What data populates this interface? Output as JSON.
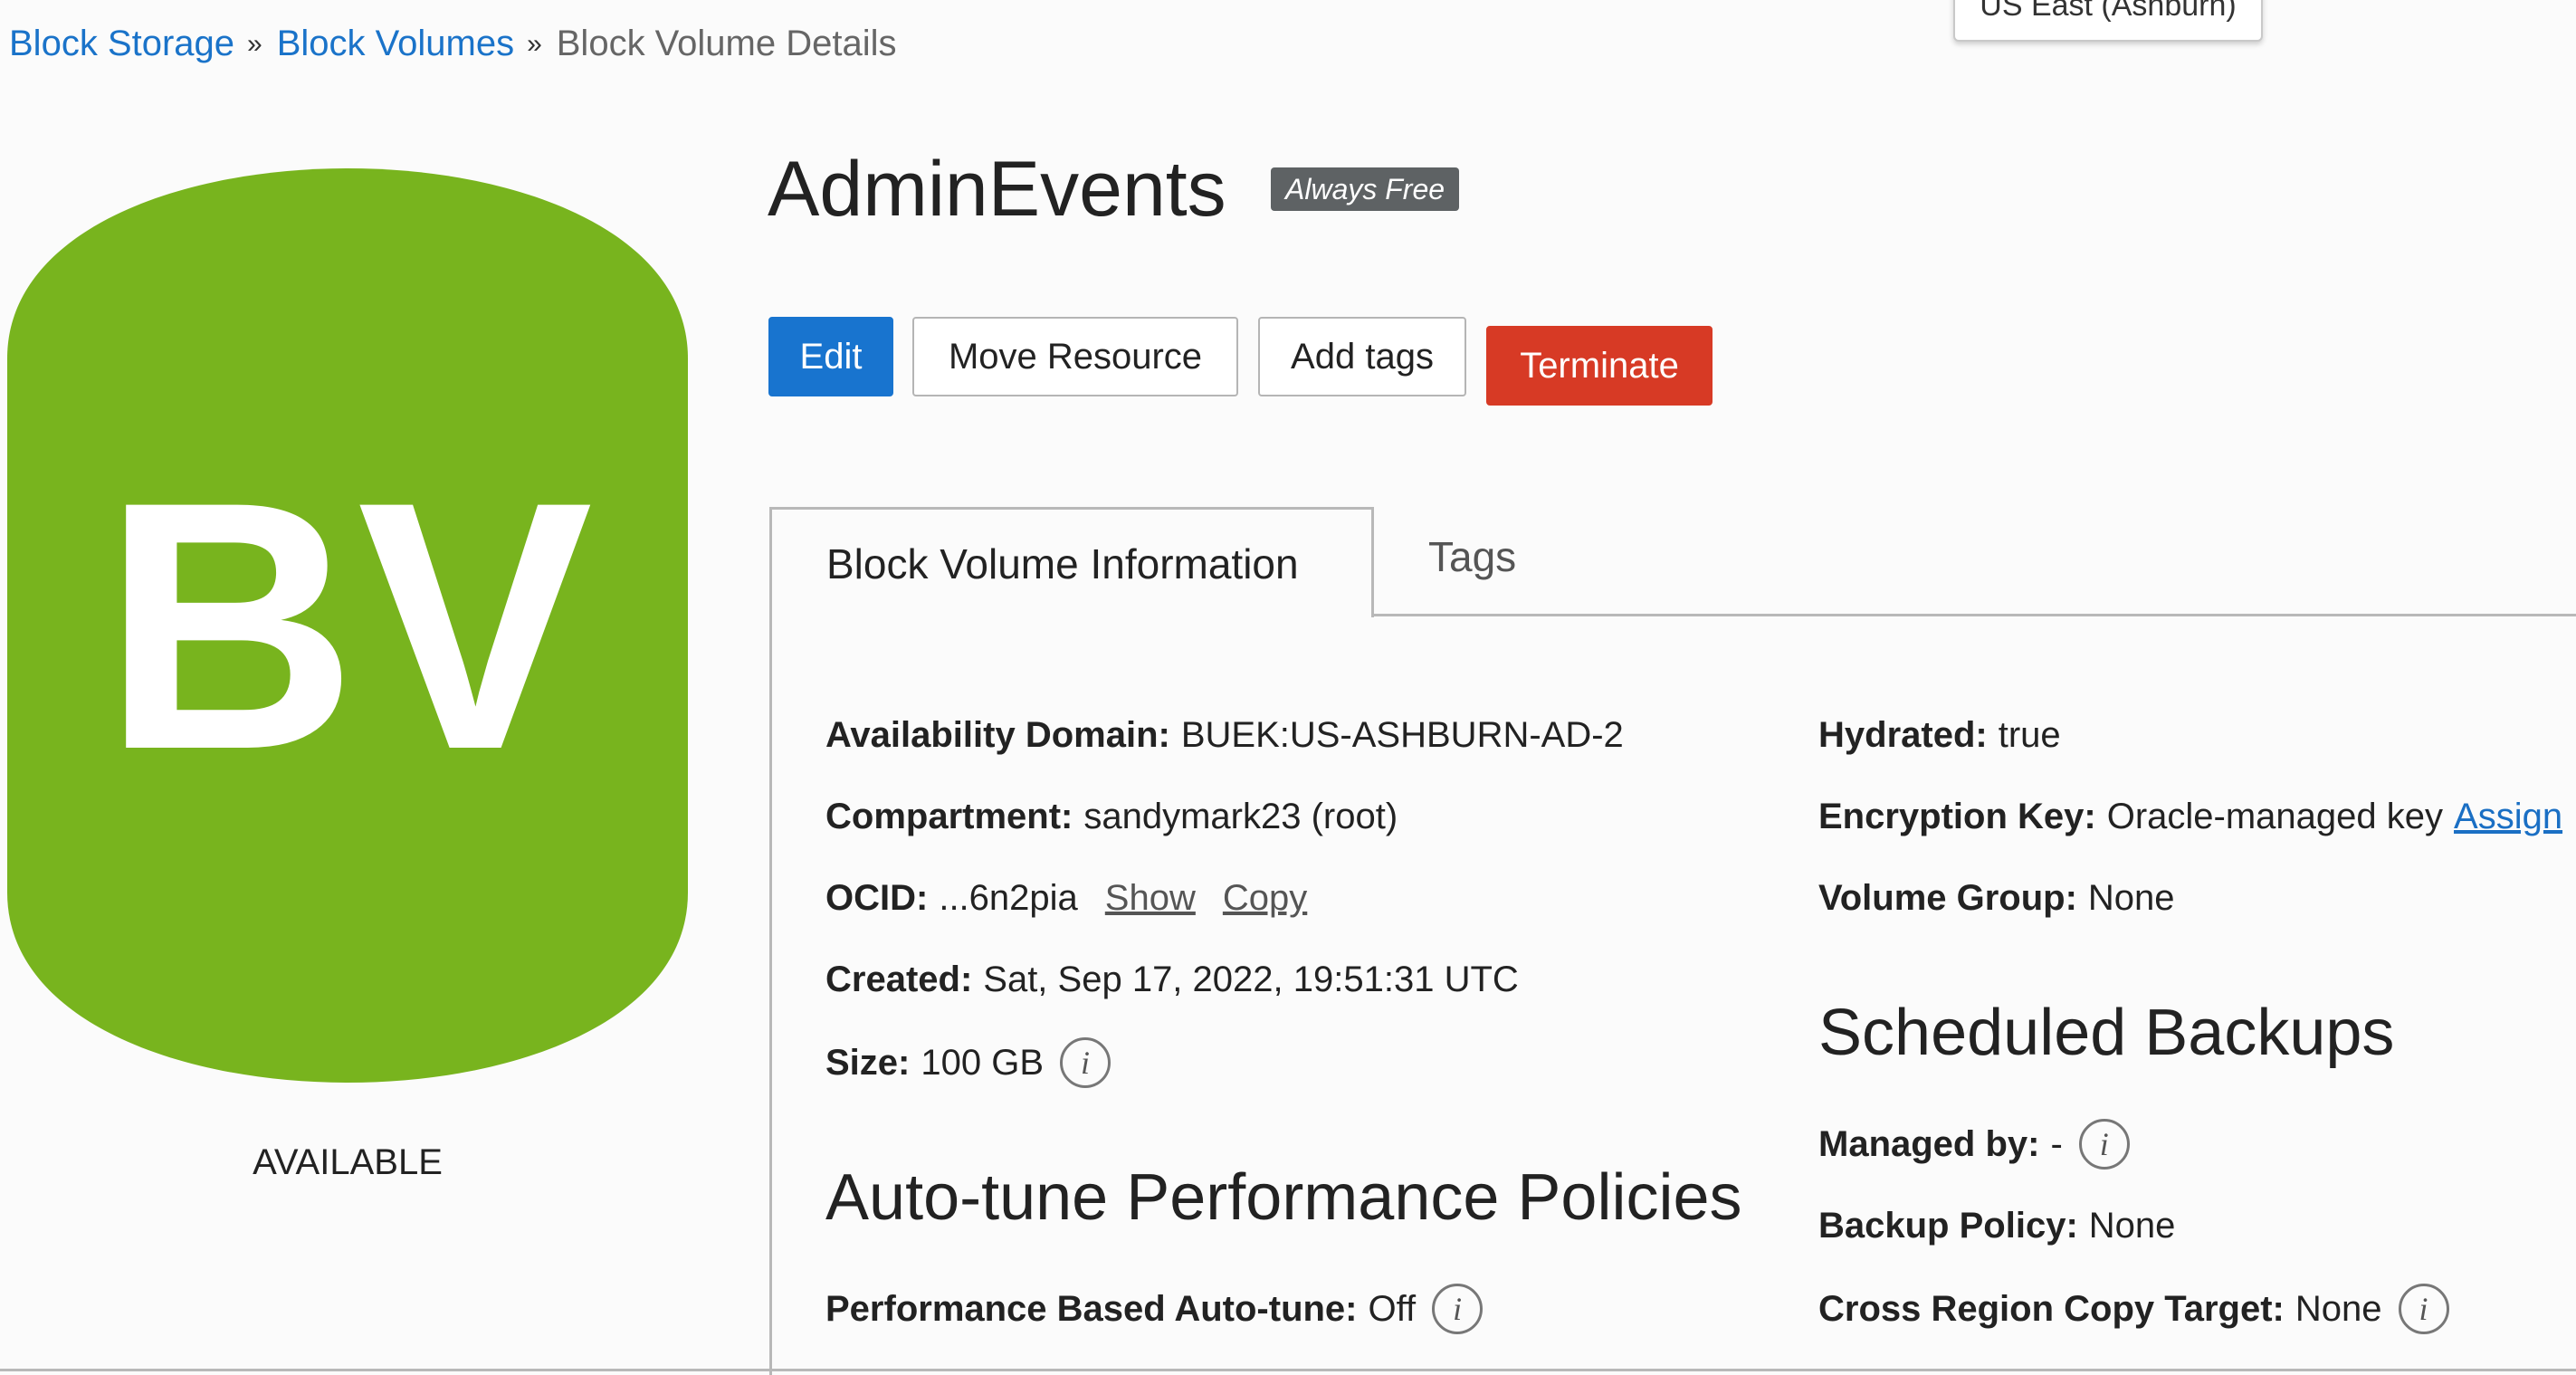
{
  "breadcrumb": {
    "items": [
      "Block Storage",
      "Block Volumes"
    ],
    "separator": "»",
    "current": "Block Volume Details"
  },
  "region": {
    "label": "US East (Ashburn)"
  },
  "resource": {
    "icon_text": "BV",
    "icon_color": "#78b41e",
    "status": "AVAILABLE",
    "name": "AdminEvents",
    "badge": "Always Free"
  },
  "actions": {
    "edit": "Edit",
    "move": "Move Resource",
    "add_tags": "Add tags",
    "terminate": "Terminate"
  },
  "colors": {
    "primary": "#1874cf",
    "danger": "#d73a25",
    "link": "#1a73c9"
  },
  "tabs": {
    "active": "Block Volume Information",
    "inactive": "Tags"
  },
  "info": {
    "availability_domain": {
      "label": "Availability Domain:",
      "value": "BUEK:US-ASHBURN-AD-2"
    },
    "compartment": {
      "label": "Compartment:",
      "value": "sandymark23 (root)"
    },
    "ocid": {
      "label": "OCID:",
      "value": "...6n2pia",
      "show": "Show",
      "copy": "Copy"
    },
    "created": {
      "label": "Created:",
      "value": "Sat, Sep 17, 2022, 19:51:31 UTC"
    },
    "size": {
      "label": "Size:",
      "value": "100 GB"
    },
    "hydrated": {
      "label": "Hydrated:",
      "value": "true"
    },
    "encryption_key": {
      "label": "Encryption Key:",
      "value": "Oracle-managed key",
      "action": "Assign"
    },
    "volume_group": {
      "label": "Volume Group:",
      "value": "None"
    }
  },
  "autotune": {
    "heading": "Auto-tune Performance Policies",
    "performance": {
      "label": "Performance Based Auto-tune:",
      "value": "Off"
    }
  },
  "backups": {
    "heading": "Scheduled Backups",
    "managed_by": {
      "label": "Managed by:",
      "value": "-"
    },
    "backup_policy": {
      "label": "Backup Policy:",
      "value": "None"
    },
    "cross_region": {
      "label": "Cross Region Copy Target:",
      "value": "None"
    }
  },
  "info_icon_glyph": "i"
}
